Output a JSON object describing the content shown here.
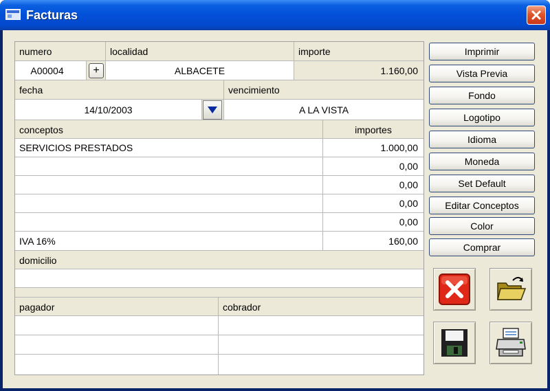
{
  "window": {
    "title": "Facturas"
  },
  "form": {
    "numero": {
      "label": "numero",
      "value": "A00004",
      "add_label": "+"
    },
    "localidad": {
      "label": "localidad",
      "value": "ALBACETE"
    },
    "importe": {
      "label": "importe",
      "value": "1.160,00"
    },
    "fecha": {
      "label": "fecha",
      "value": "14/10/2003"
    },
    "vencimiento": {
      "label": "vencimiento",
      "value": "A LA VISTA"
    },
    "conceptos": {
      "header_concepto": "conceptos",
      "header_importe": "importes",
      "rows": [
        {
          "concepto": "SERVICIOS PRESTADOS",
          "importe": "1.000,00"
        },
        {
          "concepto": "",
          "importe": "0,00"
        },
        {
          "concepto": "",
          "importe": "0,00"
        },
        {
          "concepto": "",
          "importe": "0,00"
        },
        {
          "concepto": "",
          "importe": "0,00"
        },
        {
          "concepto": "IVA 16%",
          "importe": "160,00"
        }
      ]
    },
    "domicilio": {
      "label": "domicilio",
      "value": ""
    },
    "pagador": {
      "label": "pagador"
    },
    "cobrador": {
      "label": "cobrador"
    }
  },
  "side_buttons": [
    "Imprimir",
    "Vista Previa",
    "Fondo",
    "Logotipo",
    "Idioma",
    "Moneda",
    "Set Default",
    "Editar Conceptos",
    "Color",
    "Comprar"
  ],
  "icons": {
    "cancel": "cancel-icon",
    "open": "open-folder-icon",
    "save": "save-disk-icon",
    "print": "printer-icon"
  },
  "colors": {
    "titlebar": "#0350d8",
    "background": "#ece9d8",
    "close": "#e0552a",
    "cancel": "#e02818",
    "dropdown_arrow": "#0a2aa0"
  }
}
